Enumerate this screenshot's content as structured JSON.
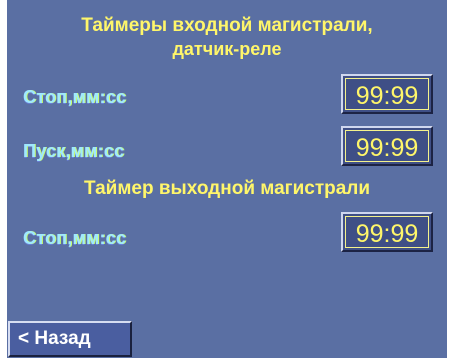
{
  "title": {
    "line1": "Таймеры входной магистрали,",
    "line2": "датчик-реле"
  },
  "input_timers": [
    {
      "label": "Стоп,мм:сс",
      "value": "99:99"
    },
    {
      "label": "Пуск,мм:сс",
      "value": "99:99"
    }
  ],
  "output_section": {
    "title": "Таймер выходной магистрали",
    "timers": [
      {
        "label": "Стоп,мм:сс",
        "value": "99:99"
      }
    ]
  },
  "back_button": {
    "label": "< Назад"
  },
  "colors": {
    "background": "#5a6fa3",
    "title_text": "#fff66a",
    "label_text": "#9fe8ff",
    "value_text": "#fff66a",
    "button_text": "#ffffff"
  }
}
